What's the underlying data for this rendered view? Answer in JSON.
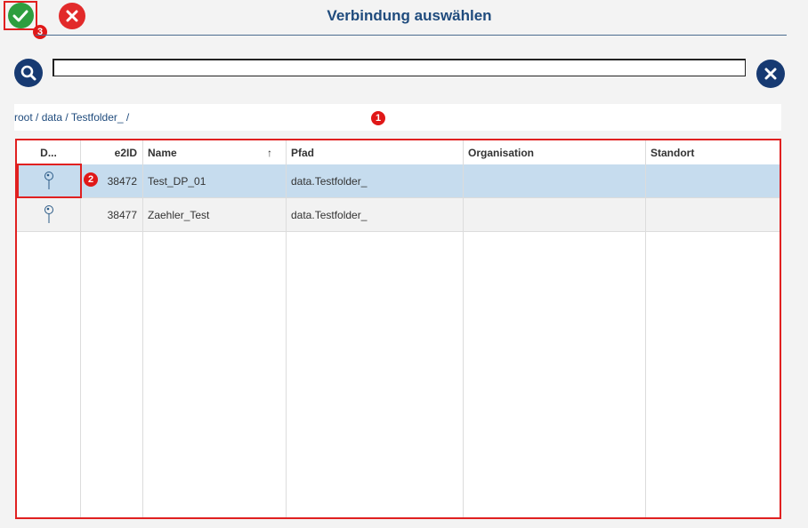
{
  "header": {
    "title": "Verbindung auswählen",
    "ok_icon": "checkmark-icon",
    "cancel_icon": "close-icon",
    "accent": "#1f4b7d"
  },
  "annotations": {
    "one": "1",
    "two": "2",
    "three": "3"
  },
  "search": {
    "value": "",
    "placeholder": "",
    "search_icon": "search-icon",
    "clear_icon": "clear-icon"
  },
  "breadcrumb": {
    "items": [
      "root",
      "data",
      "Testfolder_"
    ],
    "separator": " / ",
    "trailing": " /"
  },
  "table": {
    "columns": [
      "D...",
      "e2ID",
      "Name",
      "Pfad",
      "Organisation",
      "Standort"
    ],
    "sort_indicator": "↑",
    "rows": [
      {
        "icon": "connection-pin-icon",
        "e2id": "38472",
        "name": "Test_DP_01",
        "pfad": "data.Testfolder_",
        "organisation": "",
        "standort": "",
        "selected": true
      },
      {
        "icon": "connection-pin-icon",
        "e2id": "38477",
        "name": "Zaehler_Test",
        "pfad": "data.Testfolder_",
        "organisation": "",
        "standort": "",
        "selected": false
      }
    ]
  },
  "colors": {
    "selected_row": "#c6dcee",
    "highlight_border": "#e02020",
    "ok": "#2e9e3f",
    "cancel": "#e22a2a"
  }
}
